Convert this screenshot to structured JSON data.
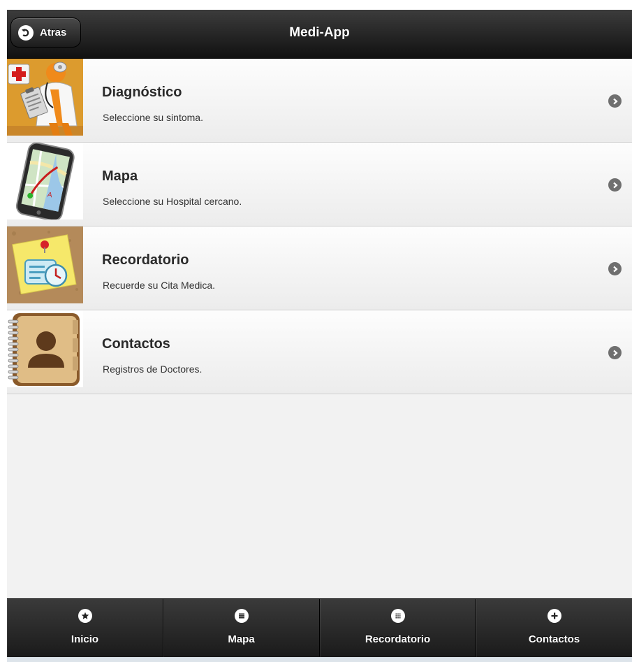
{
  "header": {
    "title": "Medi-App",
    "back_label": "Atras",
    "back_icon": "back-arrow-icon"
  },
  "list": {
    "items": [
      {
        "title": "Diagnóstico",
        "description": "Seleccione su sintoma.",
        "icon": "doctor-icon"
      },
      {
        "title": "Mapa",
        "description": "Seleccione su Hospital cercano.",
        "icon": "map-phone-icon"
      },
      {
        "title": "Recordatorio",
        "description": "Recuerde su Cita Medica.",
        "icon": "reminder-note-icon"
      },
      {
        "title": "Contactos",
        "description": "Registros de Doctores.",
        "icon": "address-book-icon"
      }
    ]
  },
  "navbar": {
    "tabs": [
      {
        "label": "Inicio",
        "icon": "star-icon"
      },
      {
        "label": "Mapa",
        "icon": "list-icon"
      },
      {
        "label": "Recordatorio",
        "icon": "grid-icon"
      },
      {
        "label": "Contactos",
        "icon": "plus-icon"
      }
    ]
  },
  "colors": {
    "header_bg": "#1a1a1a",
    "list_bg": "#f2f2f2",
    "chevron": "#6f6f6f",
    "text": "#2a2a2a"
  }
}
